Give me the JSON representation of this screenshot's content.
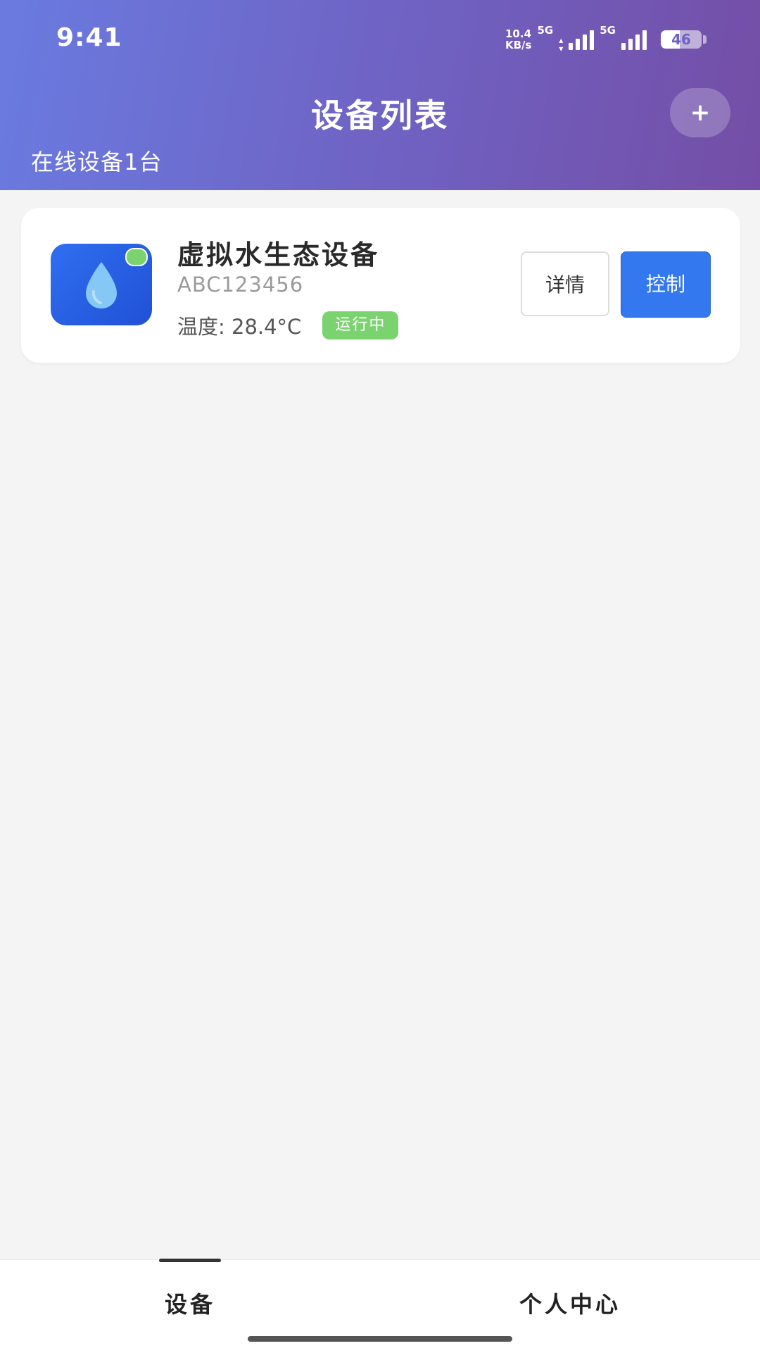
{
  "status_bar": {
    "time": "9:41",
    "net_speed_value": "10.4",
    "net_speed_unit": "KB/s",
    "network_type_1": "5G",
    "network_type_2": "5G",
    "battery": "46",
    "battery_level": 0.46
  },
  "header": {
    "title": "设备列表",
    "add_label": "+",
    "online_count": "在线设备1台"
  },
  "devices": [
    {
      "icon": "water-drop-icon",
      "name": "虚拟水生态设备",
      "serial": "ABC123456",
      "temperature": "温度: 28.4°C",
      "status": "运行中",
      "detail_label": "详情",
      "control_label": "控制"
    }
  ],
  "bottom_nav": {
    "tabs": [
      {
        "label": "设备"
      },
      {
        "label": "个人中心"
      }
    ]
  },
  "colors": {
    "header_gradient_start": "#6a7be0",
    "header_gradient_end": "#744ea6",
    "primary": "#3478ef",
    "online_green": "#7bd36f",
    "background": "#f4f4f4"
  }
}
